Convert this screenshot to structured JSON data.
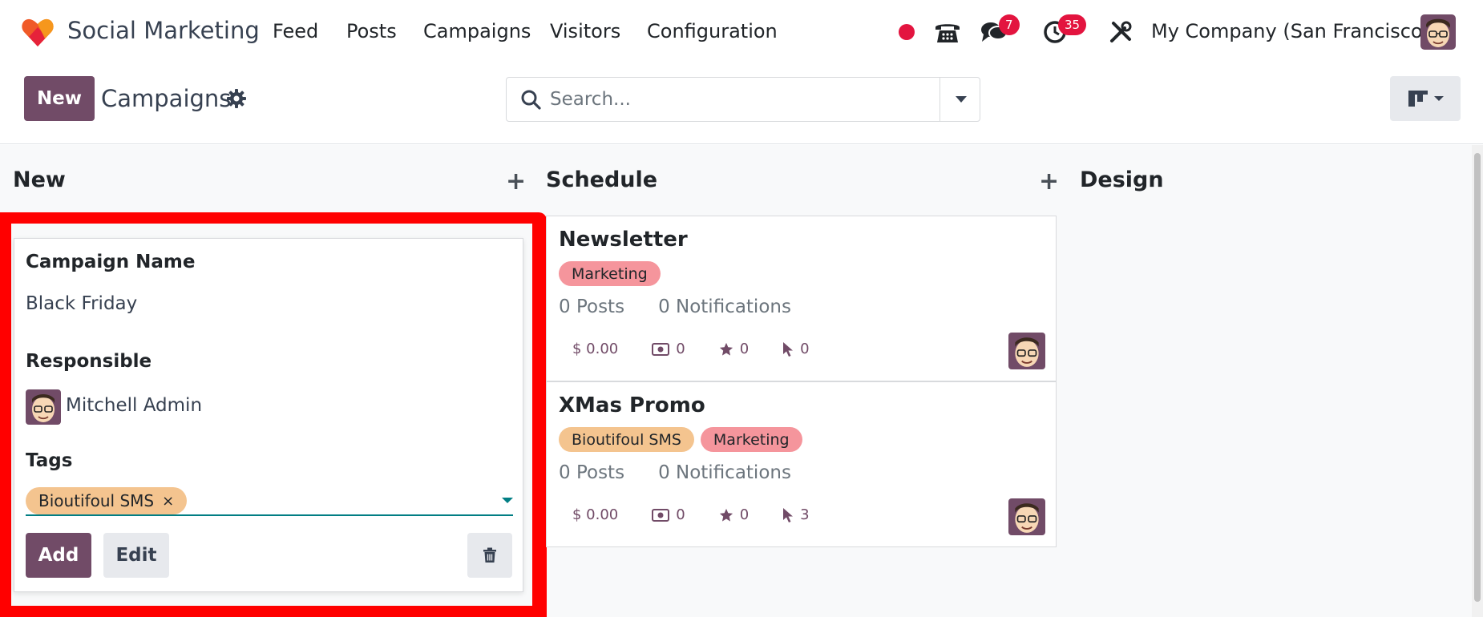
{
  "navbar": {
    "app_name": "Social Marketing",
    "menu": [
      "Feed",
      "Posts",
      "Campaigns",
      "Visitors",
      "Configuration"
    ],
    "messages_count": "7",
    "activities_count": "35",
    "company": "My Company (San Francisco)"
  },
  "control_panel": {
    "new_label": "New",
    "breadcrumb": "Campaigns",
    "search_placeholder": "Search..."
  },
  "columns": [
    {
      "title": "New"
    },
    {
      "title": "Schedule"
    },
    {
      "title": "Design"
    }
  ],
  "quick_create": {
    "name_label": "Campaign Name",
    "name_value": "Black Friday",
    "responsible_label": "Responsible",
    "responsible_value": "Mitchell Admin",
    "tags_label": "Tags",
    "tag": "Bioutifoul SMS",
    "tag_remove": "×",
    "add_label": "Add",
    "edit_label": "Edit"
  },
  "campaigns": [
    {
      "title": "Newsletter",
      "tags": [
        {
          "label": "Marketing",
          "color": "#f5959c"
        }
      ],
      "posts": "0 Posts",
      "notifications": "0 Notifications",
      "revenue": "$ 0.00",
      "sales": "0",
      "stars": "0",
      "clicks": "0"
    },
    {
      "title": "XMas Promo",
      "tags": [
        {
          "label": "Bioutifoul SMS",
          "color": "#f4c48f"
        },
        {
          "label": "Marketing",
          "color": "#f5959c"
        }
      ],
      "posts": "0 Posts",
      "notifications": "0 Notifications",
      "revenue": "$ 0.00",
      "sales": "0",
      "stars": "0",
      "clicks": "3"
    }
  ],
  "colors": {
    "brand": "#714b67",
    "highlight_frame": "#ff0000",
    "badge": "#e3143f",
    "focus": "#017e84"
  }
}
